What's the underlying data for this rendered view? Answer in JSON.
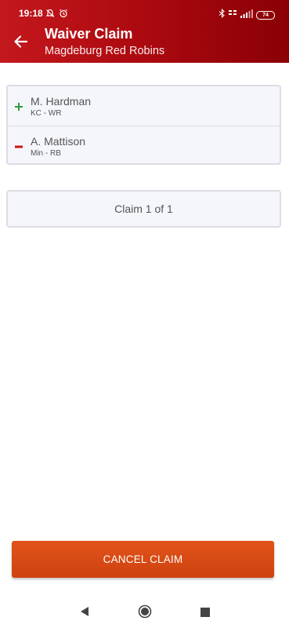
{
  "status_bar": {
    "time": "19:18",
    "battery": "74"
  },
  "header": {
    "title": "Waiver Claim",
    "subtitle": "Magdeburg Red Robins"
  },
  "players": [
    {
      "name": "M. Hardman",
      "info": "KC - WR",
      "action": "add",
      "color": "#2e9b3c"
    },
    {
      "name": "A. Mattison",
      "info": "Min - RB",
      "action": "drop",
      "color": "#cc1414"
    }
  ],
  "claim": {
    "label": "Claim 1 of 1"
  },
  "cancel_button": {
    "label": "CANCEL CLAIM"
  },
  "colors": {
    "header_start": "#c4181d",
    "header_end": "#8a0006",
    "button": "#d94a14"
  }
}
